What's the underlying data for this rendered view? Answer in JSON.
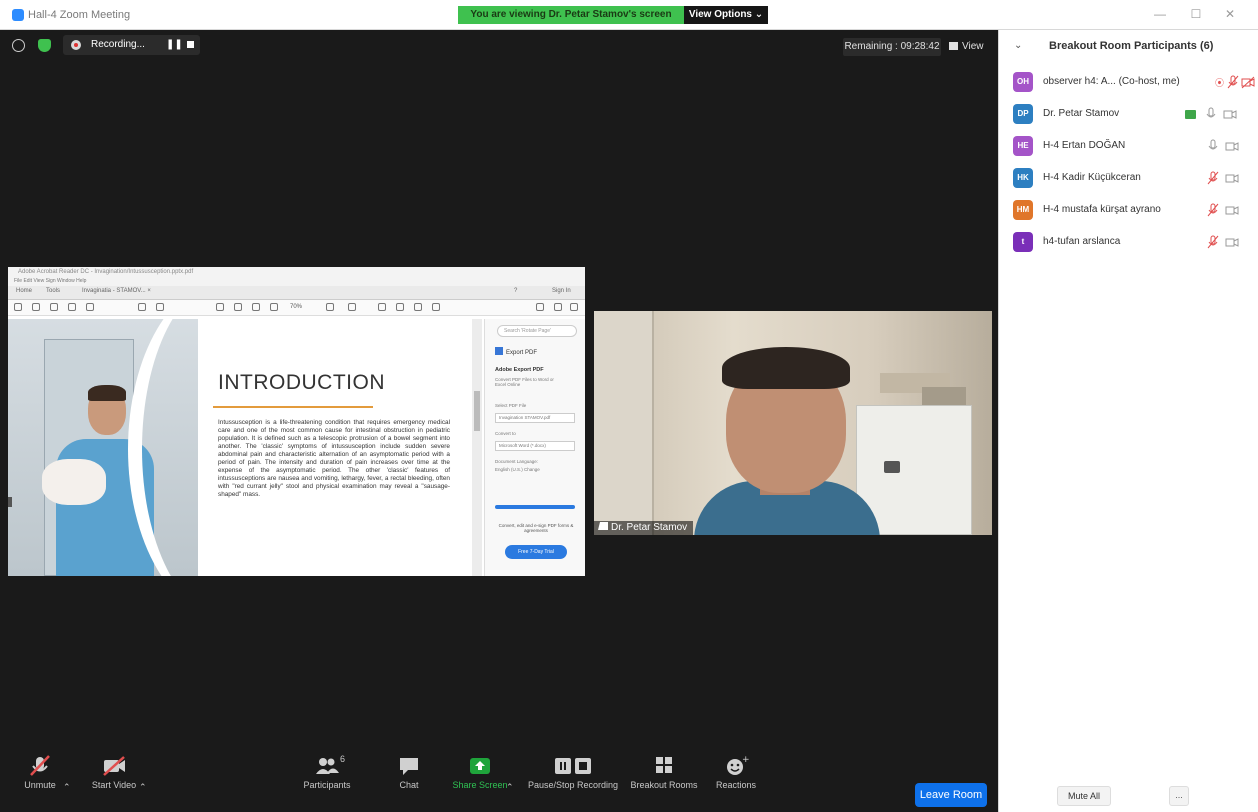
{
  "window": {
    "title": "Hall-4 Zoom Meeting",
    "share_banner": "You are viewing Dr. Petar Stamov's screen",
    "view_options": "View Options ⌄",
    "controls": [
      "—",
      "☐",
      "✕"
    ],
    "colors": {
      "banner": "#3fc14f",
      "accent": "#0e71eb"
    }
  },
  "topbar": {
    "recording_label": "Recording...",
    "pause_glyph": "❚❚",
    "remaining": "Remaining : 09:28:42",
    "view_label": "View"
  },
  "shared_screen": {
    "pdf_title": "Adobe Acrobat Reader DC - Invagination/Intussusception.pptx.pdf",
    "menu": "File  Edit  View  Sign  Window  Help",
    "tabs": [
      "Home",
      "Tools",
      "Invaginatia - STAMOV... ×"
    ],
    "help_label": "?",
    "sign_in": "Sign In",
    "zoom_level": "70%",
    "slide_title": "INTRODUCTION",
    "slide_text": "Intussusception is a life-threatening condition that requires emergency medical care and one of the most common cause for intestinal obstruction in pediatric population. It is defined such as a telescopic protrusion of a bowel segment into another. The 'classic' symptoms of intussusception include sudden severe abdominal pain and characteristic alternation of an asymptomatic period with a period of pain. The intensity and duration of pain increases over time at the expense of the asymptomatic period. The other 'classic' features of intussusceptions are nausea and vomiting, lethargy, fever, a rectal bleeding, often with \"red currant jelly\" stool and physical examination may reveal a \"sausage-shaped\" mass.",
    "side": {
      "search_placeholder": "Search 'Rotate Page'",
      "export_pdf": "Export PDF",
      "adobe_export_title": "Adobe Export PDF",
      "adobe_export_desc": "Convert PDF Files to Word or Excel Online",
      "select_pdf_label": "Select PDF File",
      "selected_file": "Invagination STAMOV.pdf",
      "convert_to_label": "Convert to",
      "convert_to_value": "Microsoft Word (*.docx)",
      "language_label": "Document Language:",
      "language_value": "English (U.S.) Change",
      "note": "Convert, edit and e-sign PDF forms & agreements",
      "trial_button": "Free 7-Day Trial"
    }
  },
  "video": {
    "name": "Dr. Petar Stamov"
  },
  "toolbar": {
    "unmute": "Unmute",
    "start_video": "Start Video",
    "participants": "Participants",
    "participants_count": "6",
    "chat": "Chat",
    "share_screen": "Share Screen",
    "pause_stop_recording": "Pause/Stop Recording",
    "breakout_rooms": "Breakout Rooms",
    "reactions": "Reactions",
    "leave_room": "Leave Room",
    "caret": "⌃"
  },
  "panel": {
    "title": "Breakout Room Participants (6)",
    "collapse": "⌄",
    "participants": [
      {
        "initials": "OH",
        "name": "observer h4: A... (Co-host, me)",
        "color": "#a454c8",
        "mic": "muted",
        "cam": "off",
        "recording": true
      },
      {
        "initials": "DP",
        "name": "Dr. Petar Stamov",
        "color": "#2d7fc1",
        "mic": "on",
        "cam": "on",
        "sharing": true
      },
      {
        "initials": "HE",
        "name": "H-4 Ertan DOĞAN",
        "color": "#a454c8",
        "mic": "on",
        "cam": "on"
      },
      {
        "initials": "HK",
        "name": "H-4 Kadir Küçükceran",
        "color": "#2d7fc1",
        "mic": "muted",
        "cam": "on"
      },
      {
        "initials": "HM",
        "name": "H-4 mustafa kürşat ayrano",
        "color": "#e0762a",
        "mic": "muted",
        "cam": "on"
      },
      {
        "initials": "t",
        "name": "h4-tufan arslanca",
        "color": "#7a2fb8",
        "mic": "muted",
        "cam": "on"
      }
    ],
    "mute_all": "Mute All",
    "more": "..."
  }
}
